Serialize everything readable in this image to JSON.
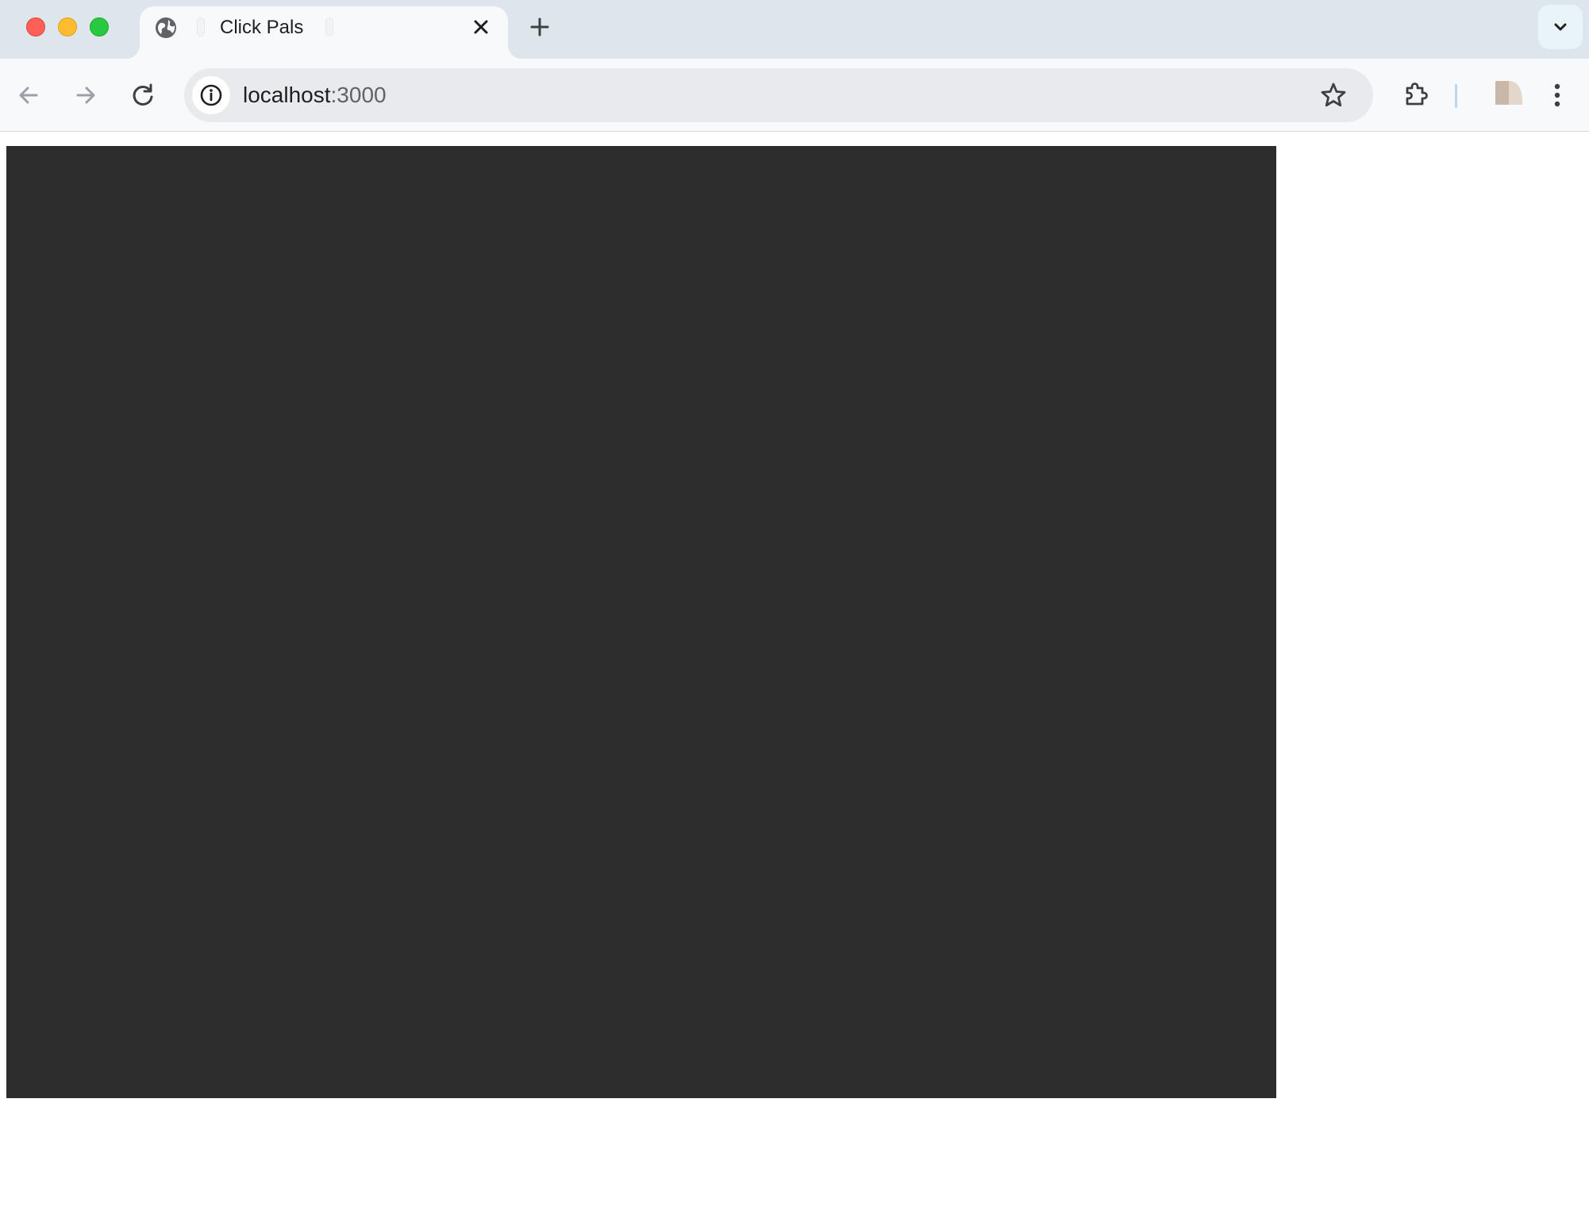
{
  "browser": {
    "tab": {
      "title": "Click Pals"
    },
    "address_bar": {
      "host": "localhost",
      "port": ":3000"
    }
  },
  "colors": {
    "canvas_background": "#2d2d2d",
    "page_background": "#ffffff"
  },
  "icons": {
    "favicon": "globe-icon",
    "tab_close": "close-icon",
    "new_tab": "plus-icon",
    "tab_search": "chevron-down-icon",
    "back": "arrow-left-icon",
    "forward": "arrow-right-icon",
    "reload": "reload-icon",
    "site_info": "info-icon",
    "bookmark": "star-icon",
    "extensions": "puzzle-icon",
    "profile": "avatar",
    "menu": "kebab-menu-icon"
  }
}
